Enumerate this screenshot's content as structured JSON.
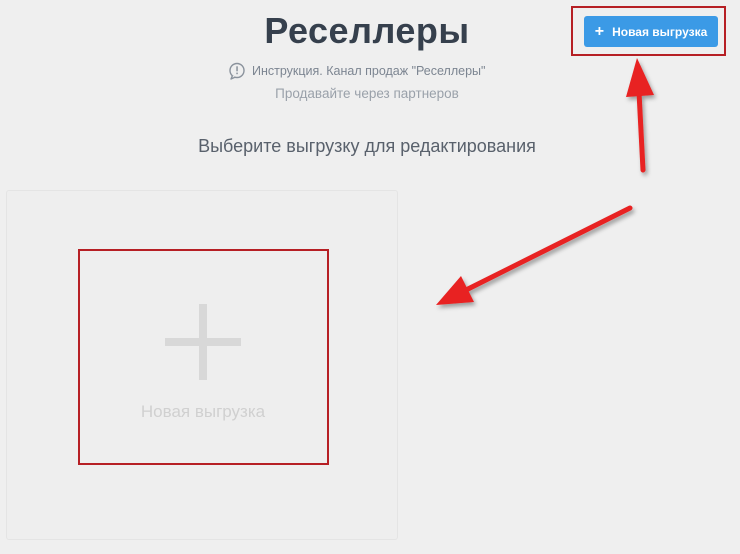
{
  "header": {
    "title": "Реселлеры",
    "instruction": "Инструкция. Канал продаж \"Реселлеры\"",
    "subtitle": "Продавайте через партнеров"
  },
  "toolbar": {
    "new_export_label": "Новая выгрузка",
    "new_export_icon": "plus-icon"
  },
  "main": {
    "prompt": "Выберите выгрузку для редактирования",
    "new_card": {
      "label": "Новая выгрузка",
      "icon": "plus-icon"
    }
  },
  "annotations": {
    "highlight_color": "#b61f24",
    "arrow_color": "#e82020"
  },
  "colors": {
    "accent": "#3b9ae6",
    "background": "#efefef"
  }
}
